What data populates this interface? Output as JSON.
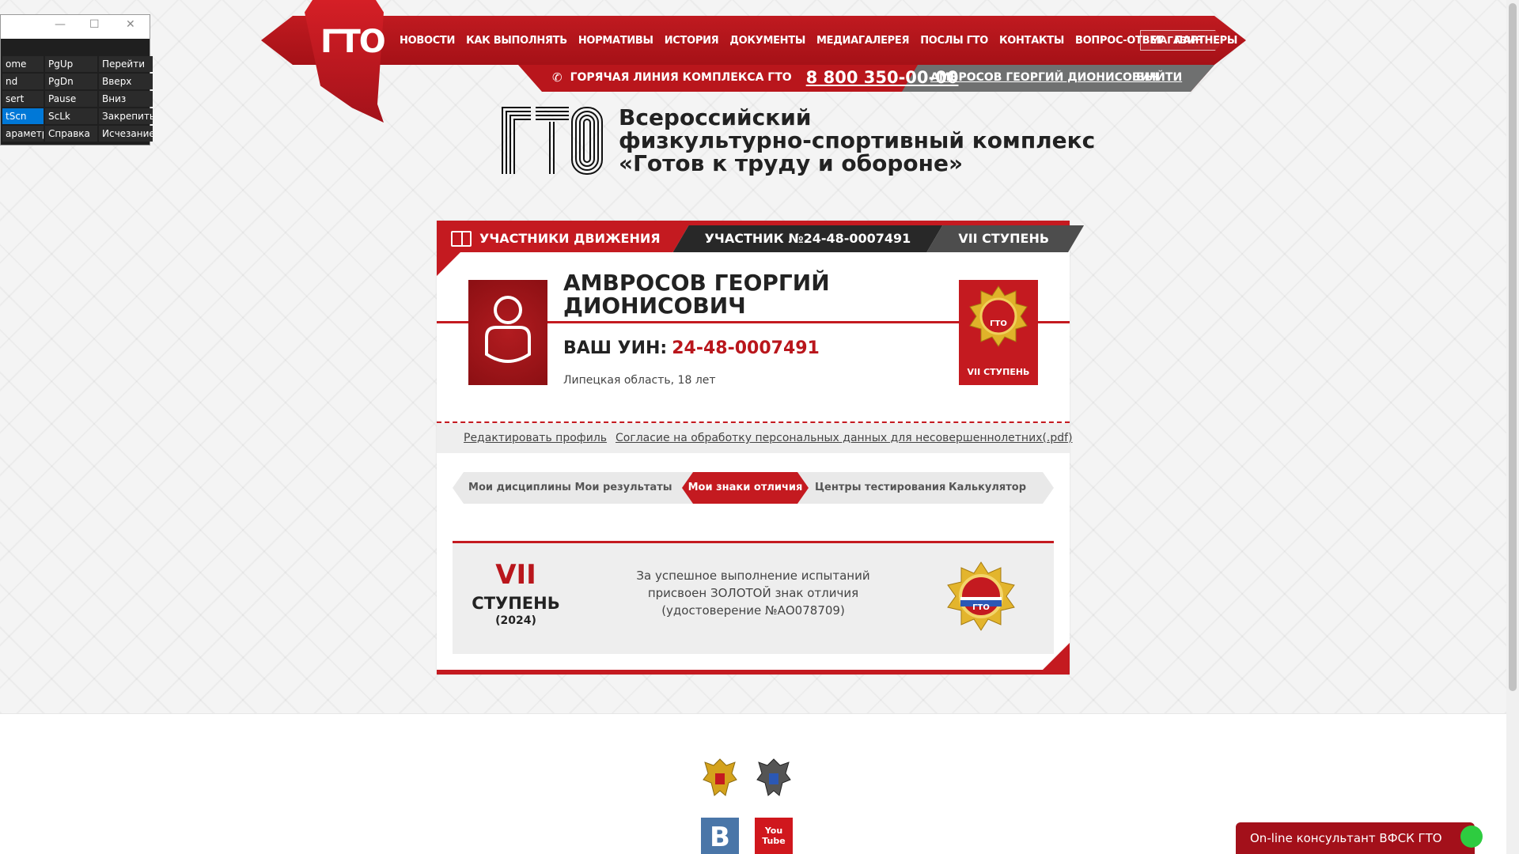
{
  "header": {
    "logo_text": "ГТО",
    "nav": [
      "НОВОСТИ",
      "КАК ВЫПОЛНЯТЬ",
      "НОРМАТИВЫ",
      "ИСТОРИЯ",
      "ДОКУМЕНТЫ",
      "МЕДИАГАЛЕРЕЯ",
      "ПОСЛЫ ГТО",
      "КОНТАКТЫ",
      "ВОПРОС-ОТВЕТ",
      "ПАРТНЕРЫ"
    ],
    "shop": "МАГАЗИН",
    "hotline_label": "ГОРЯЧАЯ ЛИНИЯ КОМПЛЕКСА ГТО",
    "hotline_number": "8 800 350-00-00",
    "user_name": "АМВРОСОВ ГЕОРГИЙ ДИОНИСОВИЧ",
    "logout": "ВЫЙТИ"
  },
  "brand": {
    "logo_big": "ГТО",
    "tagline_line1": "Всероссийский",
    "tagline_line2": "физкультурно-спортивный комплекс",
    "tagline_line3": "«Готов к труду и обороне»"
  },
  "profile": {
    "tab_participants": "УЧАСТНИКИ ДВИЖЕНИЯ",
    "tab_participant_no": "УЧАСТНИК №24-48-0007491",
    "tab_stage": "VII СТУПЕНЬ",
    "name": "АМВРОСОВ ГЕОРГИЙ ДИОНИСОВИЧ",
    "uin_label": "ВАШ УИН:",
    "uin_value": "24-48-0007491",
    "region": "Липецкая область, 18 лет",
    "badge_label": "VII СТУПЕНЬ",
    "link_edit": "Редактировать профиль",
    "link_consent": "Согласие на обработку персональных данных для несовершеннолетних(.pdf)"
  },
  "subnav": {
    "items": [
      "Мои дисциплины",
      "Мои результаты",
      "Мои знаки отличия",
      "Центры тестирования",
      "Калькулятор"
    ],
    "active": "Мои знаки отличия"
  },
  "award": {
    "stage_roman": "VII",
    "stage_word": "СТУПЕНЬ",
    "year": "(2024)",
    "text_line1": "За успешное выполнение испытаний",
    "text_line2": "присвоен ЗОЛОТОЙ знак отличия",
    "text_line3": "(удостоверение №АО078709)"
  },
  "keyboard": {
    "keys": [
      [
        "ome",
        "PgUp",
        "Перейти"
      ],
      [
        "nd",
        "PgDn",
        "Вверх"
      ],
      [
        "sert",
        "Pause",
        "Вниз"
      ],
      [
        "tScn",
        "ScLk",
        "Закрепить"
      ],
      [
        "араметры",
        "Справка",
        "Исчезание"
      ]
    ],
    "minimize": "—",
    "maximize": "☐",
    "close": "✕"
  },
  "footer": {
    "vk": "B",
    "youtube": "You Tube",
    "consultant": "On-line консультант ВФСК ГТО"
  },
  "colors": {
    "brand_red": "#c41a20",
    "dark": "#282828",
    "gold": "#d9a21a"
  }
}
